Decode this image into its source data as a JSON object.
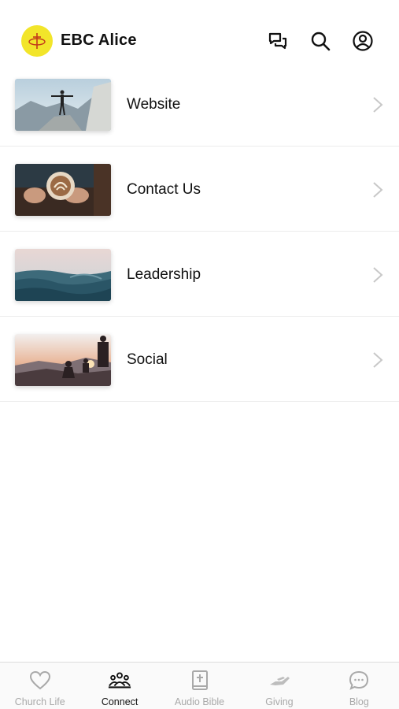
{
  "header": {
    "title": "EBC Alice",
    "logo_color": "#f2e52a"
  },
  "items": [
    {
      "label": "Website",
      "thumb": "person-on-mountain"
    },
    {
      "label": "Contact Us",
      "thumb": "latte-art-cup"
    },
    {
      "label": "Leadership",
      "thumb": "ocean-waves"
    },
    {
      "label": "Social",
      "thumb": "sunset-silhouettes"
    }
  ],
  "tabs": [
    {
      "label": "Church Life",
      "icon": "heart-icon",
      "active": false
    },
    {
      "label": "Connect",
      "icon": "people-group-icon",
      "active": true
    },
    {
      "label": "Audio Bible",
      "icon": "bible-icon",
      "active": false
    },
    {
      "label": "Giving",
      "icon": "giving-hand-icon",
      "active": false
    },
    {
      "label": "Blog",
      "icon": "chat-bubble-icon",
      "active": false
    }
  ],
  "colors": {
    "active_tab": "#111111",
    "inactive_tab": "#a9a9a9",
    "divider": "#ececec"
  }
}
